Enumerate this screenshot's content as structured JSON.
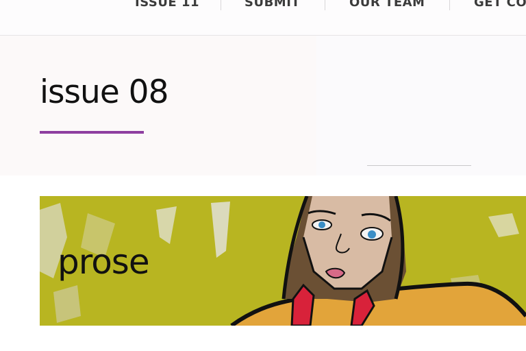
{
  "nav": {
    "items": [
      {
        "label": "ISSUE 11"
      },
      {
        "label": "SUBMIT"
      },
      {
        "label": "OUR TEAM"
      },
      {
        "label": "GET CO"
      }
    ]
  },
  "hero": {
    "title": "issue 08"
  },
  "section_card": {
    "label": "prose",
    "image_description": "painted illustration of a woman's face on a yellow background",
    "background_color": "#b5b21f"
  },
  "colors": {
    "accent": "#8e3fa0",
    "text": "#111111",
    "nav_text": "#3b3b3b"
  }
}
